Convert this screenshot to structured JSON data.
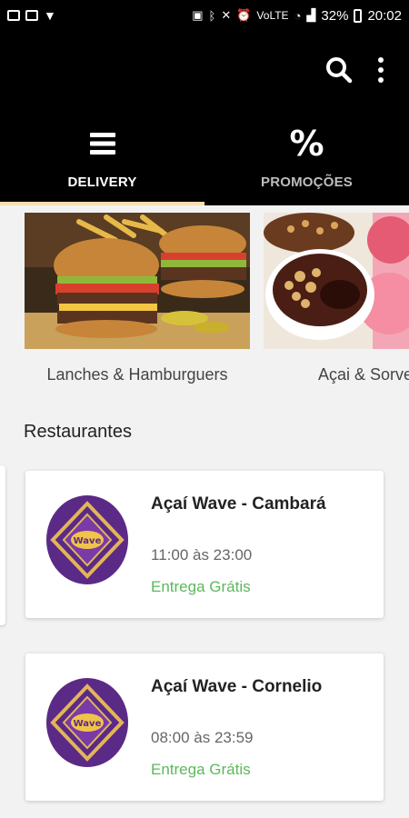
{
  "status_bar": {
    "battery": "32%",
    "time": "20:02",
    "network": "VoLTE"
  },
  "tabs": [
    {
      "label": "DELIVERY",
      "icon": "menu-icon",
      "active": true
    },
    {
      "label": "PROMOÇÕES",
      "icon": "percent-icon",
      "glyph": "%",
      "active": false
    }
  ],
  "categories": [
    {
      "label": "Lanches & Hamburguers",
      "icon": "burger-image"
    },
    {
      "label": "Açai & Sorvetes",
      "icon": "acai-image"
    }
  ],
  "section_title": "Restaurantes",
  "restaurants": [
    {
      "name": "Açaí Wave - Cambará",
      "hours": "11:00 às 23:00",
      "delivery": "Entrega Grátis"
    },
    {
      "name": "Açaí Wave - Cornelio",
      "hours": "08:00 às 23:59",
      "delivery": "Entrega Grátis"
    }
  ],
  "colors": {
    "appbar": "#000000",
    "tab_indicator": "#f5deb3",
    "delivery_text": "#5cb85c",
    "logo_bg": "#5b2a86"
  }
}
